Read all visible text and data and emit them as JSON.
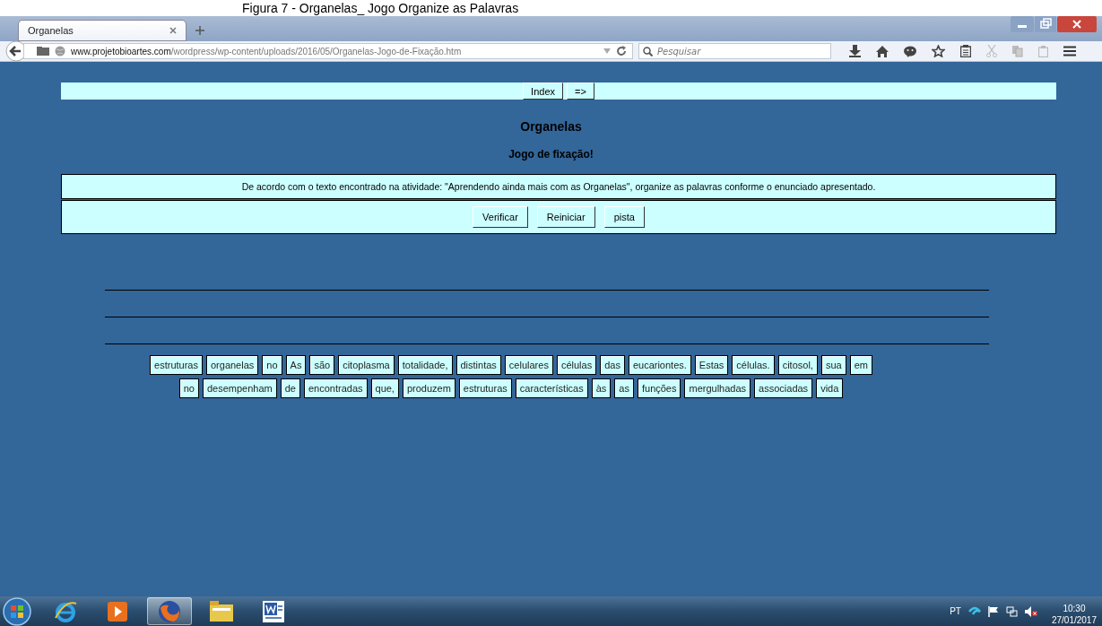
{
  "caption": "Figura 7 - Organelas_ Jogo  Organize as Palavras",
  "browser": {
    "tabs": [
      {
        "title": "Organelas",
        "selected": true
      }
    ],
    "url_host": "www.projetobioartes.com",
    "url_path": "/wordpress/wp-content/uploads/2016/05/Organelas-Jogo-de-Fixação.htm",
    "search": {
      "placeholder": "Pesquisar"
    }
  },
  "page": {
    "nav_buttons": [
      "Index",
      "=>"
    ],
    "title": "Organelas",
    "subtitle": "Jogo de fixação!",
    "instruction": "De acordo com o texto encontrado na atividade: \"Aprendendo ainda mais com as Organelas\", organize as palavras conforme o enunciado apresentado.",
    "buttons": [
      "Verificar",
      "Reiniciar",
      "pista"
    ],
    "word_rows": [
      [
        "estruturas",
        "organelas",
        "no",
        "As",
        "são",
        "citoplasma",
        "totalidade,",
        "distintas",
        "celulares",
        "células",
        "das",
        "eucariontes.",
        "Estas",
        "células.",
        "citosol,",
        "sua",
        "em"
      ],
      [
        "no",
        "desempenham",
        "de",
        "encontradas",
        "que,",
        "produzem",
        "estruturas",
        "características",
        "às",
        "as",
        "funções",
        "mergulhadas",
        "associadas",
        "vida"
      ]
    ]
  },
  "taskbar": {
    "apps": [
      {
        "kind": "ie",
        "selected": false
      },
      {
        "kind": "media",
        "selected": false
      },
      {
        "kind": "firefox",
        "selected": true
      },
      {
        "kind": "folder",
        "selected": false
      },
      {
        "kind": "word",
        "selected": false
      }
    ],
    "language": "PT",
    "time": "10:30",
    "date": "27/01/2017"
  }
}
